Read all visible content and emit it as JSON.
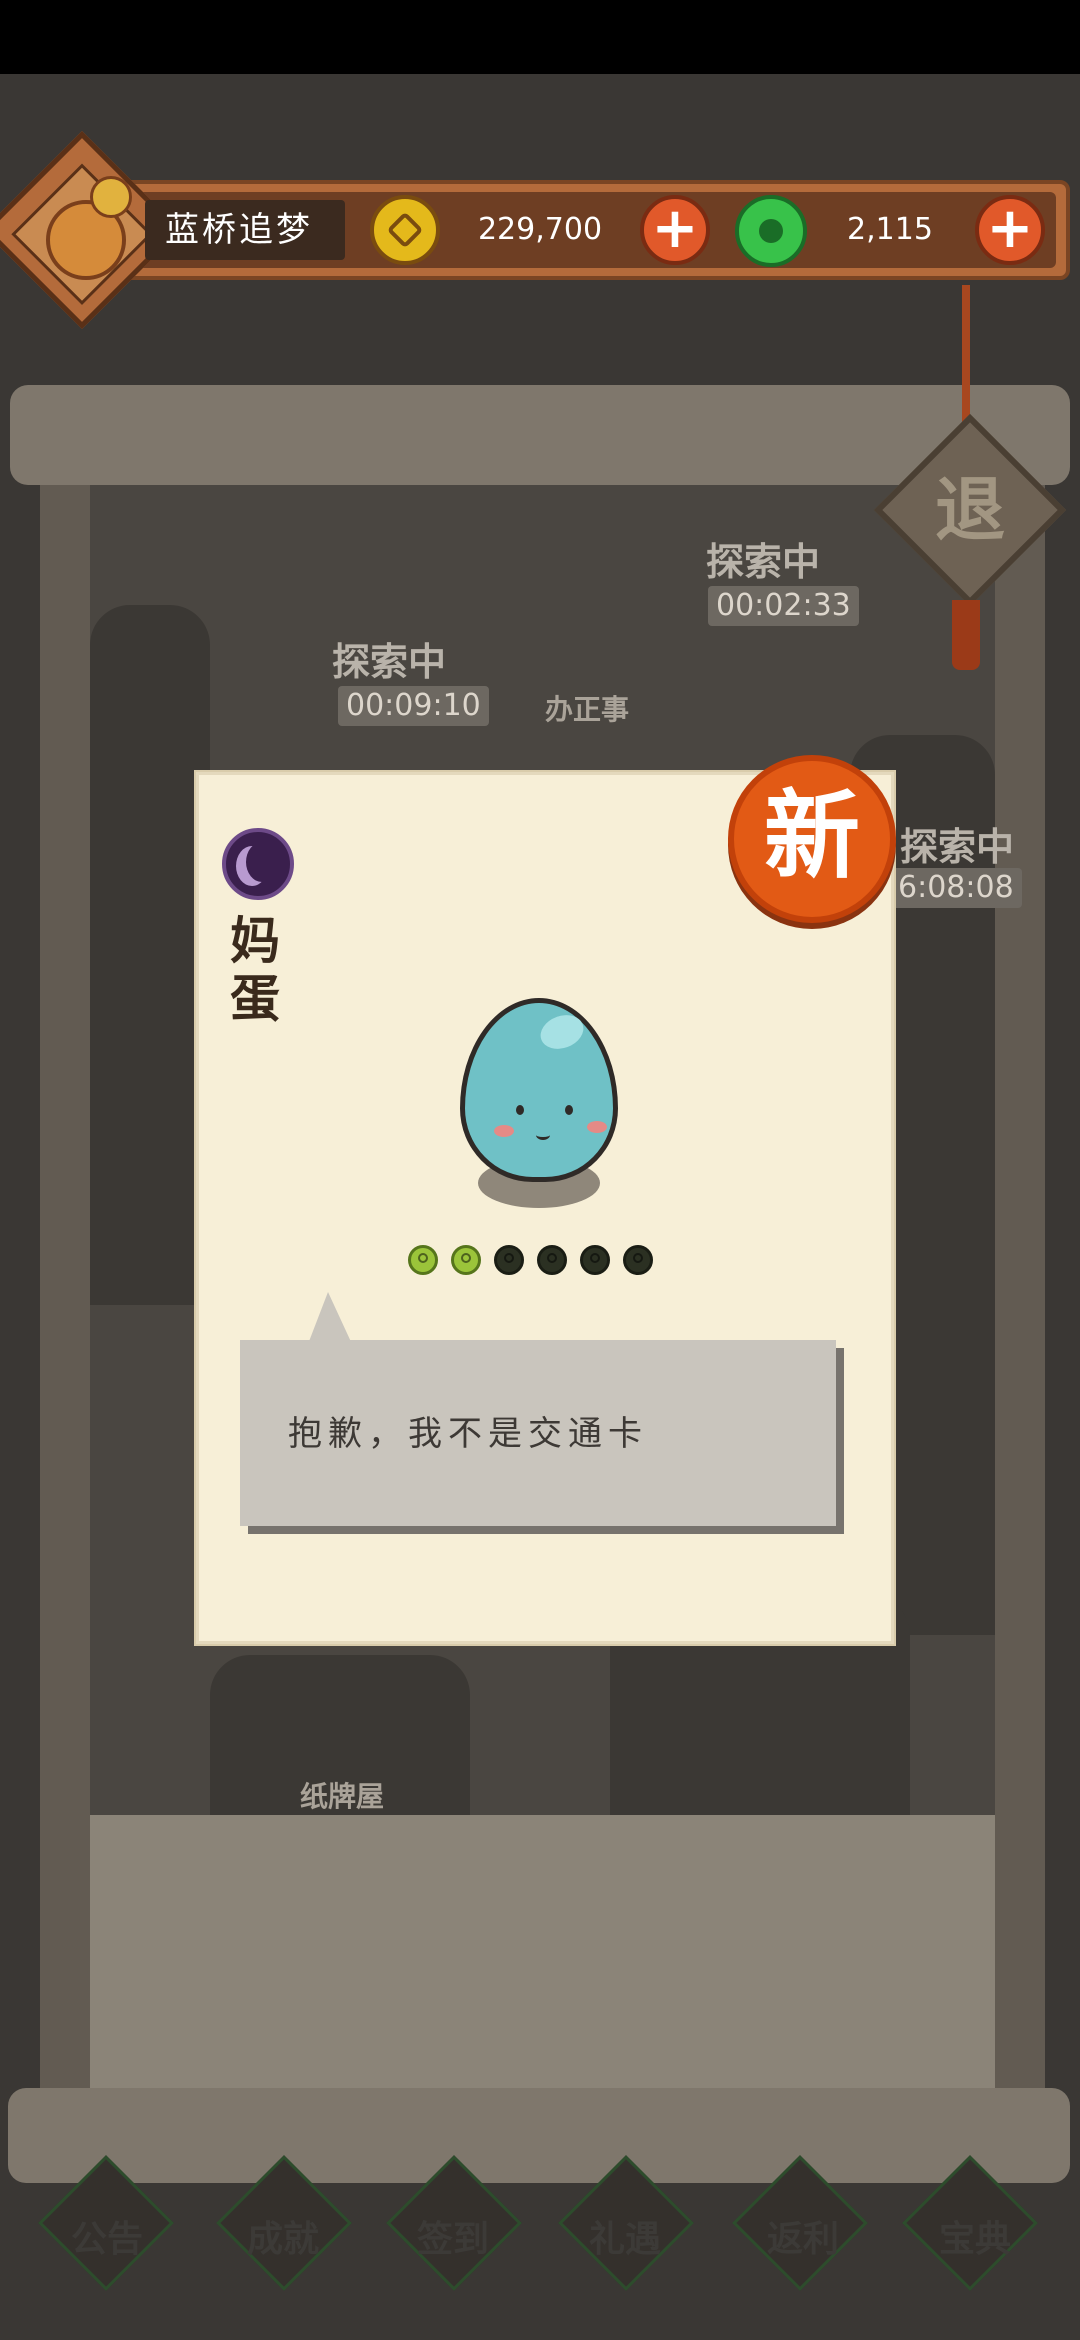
{
  "header": {
    "player_name": "蓝桥追梦",
    "coins": "229,700",
    "jade": "2,115"
  },
  "exit_button_label": "退",
  "map": {
    "expeditions": [
      {
        "status": "探索中",
        "timer": "00:09:10"
      },
      {
        "status": "探索中",
        "timer": "00:02:33"
      },
      {
        "status": "探索中",
        "timer": "6:08:08"
      }
    ],
    "locations": [
      {
        "label": "办正事"
      },
      {
        "label": "纸牌屋"
      }
    ]
  },
  "bottom_nav": [
    {
      "label": "公告"
    },
    {
      "label": "成就"
    },
    {
      "label": "签到"
    },
    {
      "label": "礼遇"
    },
    {
      "label": "返利"
    },
    {
      "label": "宝典"
    }
  ],
  "card": {
    "new_badge": "新",
    "name": "妈蛋",
    "stars_filled": 2,
    "stars_total": 6,
    "quote": "抱歉，我不是交通卡",
    "rarity_color": "#3a1f4d"
  },
  "colors": {
    "coin": "#e4b91b",
    "jade": "#38c24a",
    "plus_button": "#e1592a",
    "new_badge": "#e25a15",
    "egg": "#6fc1c6"
  },
  "icons": [
    "coin-icon",
    "jade-icon",
    "plus-icon",
    "rarity-moon-icon",
    "egg-character"
  ]
}
